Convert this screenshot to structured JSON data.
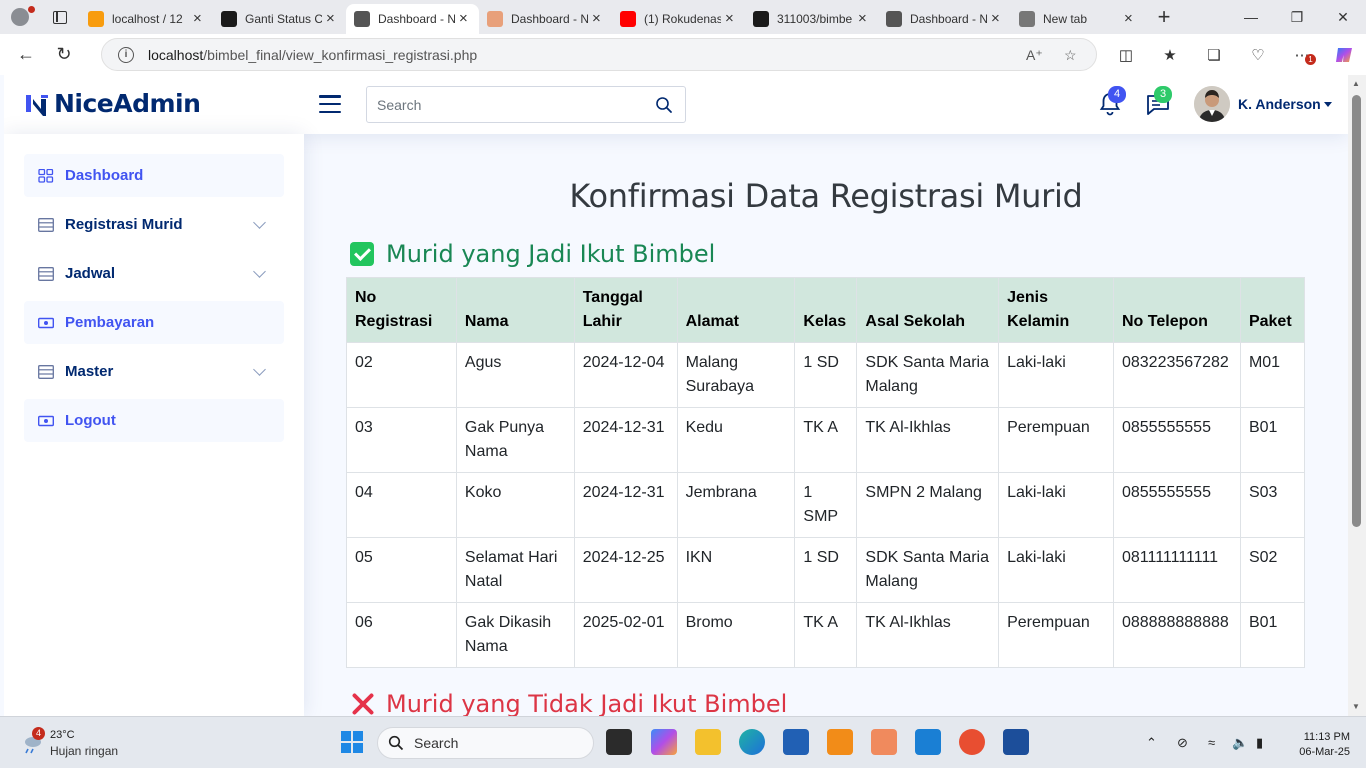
{
  "browser": {
    "tabs": [
      {
        "title": "localhost / 12",
        "favicon_color": "#f89c0e",
        "active": false
      },
      {
        "title": "Ganti Status C",
        "favicon_color": "#1a1a1a",
        "active": false
      },
      {
        "title": "Dashboard - N",
        "favicon_color": "#555555",
        "active": true
      },
      {
        "title": "Dashboard - N",
        "favicon_color": "#e8a07a",
        "active": false
      },
      {
        "title": "(1) Rokudenas",
        "favicon_color": "#ff0000",
        "active": false
      },
      {
        "title": "311003/bimbe",
        "favicon_color": "#1a1a1a",
        "active": false
      },
      {
        "title": "Dashboard - N",
        "favicon_color": "#555555",
        "active": false
      },
      {
        "title": "New tab",
        "favicon_color": "#777777",
        "active": false
      }
    ],
    "url_host": "localhost",
    "url_path": "/bimbel_final/view_konfirmasi_registrasi.php",
    "extension_badge": "1"
  },
  "header": {
    "logo_text": "NiceAdmin",
    "search_placeholder": "Search",
    "notifications_count": "4",
    "messages_count": "3",
    "user_name": "K. Anderson"
  },
  "sidebar": {
    "items": [
      {
        "label": "Dashboard",
        "expandable": false,
        "highlight": true
      },
      {
        "label": "Registrasi Murid",
        "expandable": true,
        "highlight": false
      },
      {
        "label": "Jadwal",
        "expandable": true,
        "highlight": false
      },
      {
        "label": "Pembayaran",
        "expandable": false,
        "highlight": true
      },
      {
        "label": "Master",
        "expandable": true,
        "highlight": false
      },
      {
        "label": "Logout",
        "expandable": false,
        "highlight": true
      }
    ]
  },
  "main": {
    "title": "Konfirmasi Data Registrasi Murid",
    "section_yes": "Murid yang Jadi Ikut Bimbel",
    "section_no": "Murid yang Tidak Jadi Ikut Bimbel",
    "table": {
      "headers": [
        "No Registrasi",
        "Nama",
        "Tanggal Lahir",
        "Alamat",
        "Kelas",
        "Asal Sekolah",
        "Jenis Kelamin",
        "No Telepon",
        "Paket"
      ],
      "rows": [
        [
          "02",
          "Agus",
          "2024-12-04",
          "Malang Surabaya",
          "1 SD",
          "SDK Santa Maria Malang",
          "Laki-laki",
          "083223567282",
          "M01"
        ],
        [
          "03",
          "Gak Punya Nama",
          "2024-12-31",
          "Kedu",
          "TK A",
          "TK Al-Ikhlas",
          "Perempuan",
          "0855555555",
          "B01"
        ],
        [
          "04",
          "Koko",
          "2024-12-31",
          "Jembrana",
          "1 SMP",
          "SMPN 2 Malang",
          "Laki-laki",
          "0855555555",
          "S03"
        ],
        [
          "05",
          "Selamat Hari Natal",
          "2024-12-25",
          "IKN",
          "1 SD",
          "SDK Santa Maria Malang",
          "Laki-laki",
          "081111111111",
          "S02"
        ],
        [
          "06",
          "Gak Dikasih Nama",
          "2025-02-01",
          "Bromo",
          "TK A",
          "TK Al-Ikhlas",
          "Perempuan",
          "088888888888",
          "B01"
        ]
      ]
    }
  },
  "taskbar": {
    "weather_temp": "23°C",
    "weather_desc": "Hujan ringan",
    "weather_badge": "4",
    "search_label": "Search",
    "time": "11:13 PM",
    "date": "06-Mar-25"
  },
  "colors": {
    "brand": "#012970",
    "accent": "#4154f1",
    "success": "#198754",
    "danger": "#dc3545",
    "table_header": "#d1e7dd"
  }
}
